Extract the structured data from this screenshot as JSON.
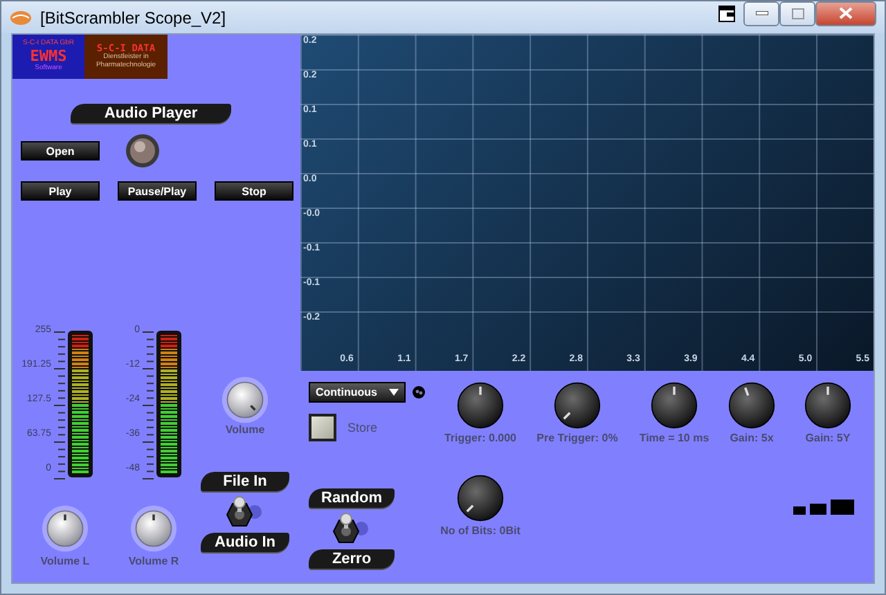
{
  "window": {
    "title": "[BitScrambler Scope_V2]"
  },
  "logos": [
    {
      "kind": "ewms",
      "top": "S-C-I DATA GbR",
      "name": "EWMS",
      "sub": "Software"
    },
    {
      "kind": "sci",
      "name": "S-C-I DATA",
      "sub": "Dienstleister in Pharmatechnologie"
    }
  ],
  "audio_player": {
    "title": "Audio Player",
    "open_button": "Open",
    "transport_buttons": [
      "Play",
      "Pause/Play",
      "Stop"
    ]
  },
  "meters": [
    {
      "scale": [
        "255",
        "191.25",
        "127.5",
        "63.75",
        "0"
      ],
      "knob": {
        "label": "Volume L"
      }
    },
    {
      "scale": [
        "0",
        "-12",
        "-24",
        "-36",
        "-48"
      ],
      "knob": {
        "label": "Volume R"
      }
    }
  ],
  "volume_knob": {
    "label": "Volume"
  },
  "input_switch": {
    "options": [
      {
        "label": "File In",
        "selected": true
      },
      {
        "label": "Audio In",
        "selected": false
      }
    ]
  },
  "scope": {
    "y_labels": [
      "0.2",
      "0.2",
      "0.1",
      "0.1",
      "0.0",
      "-0.0",
      "-0.1",
      "-0.1",
      "-0.2"
    ],
    "x_labels": [
      "0.6",
      "1.1",
      "1.7",
      "2.2",
      "2.8",
      "3.3",
      "3.9",
      "4.4",
      "5.0",
      "5.5"
    ]
  },
  "mode_dropdown": {
    "value": "Continuous"
  },
  "store": {
    "label": "Store",
    "checked": false
  },
  "knobs": [
    {
      "label": "Trigger: 0.000"
    },
    {
      "label": "Pre Trigger: 0%"
    },
    {
      "label": "Time = 10 ms"
    },
    {
      "label": "Gain: 5x"
    },
    {
      "label": "Gain: 5Y"
    }
  ],
  "fill_switch": {
    "options": [
      {
        "label": "Random",
        "selected": true
      },
      {
        "label": "Zerro",
        "selected": false
      }
    ]
  },
  "bits_knob": {
    "label": "No of Bits: 0Bit"
  }
}
